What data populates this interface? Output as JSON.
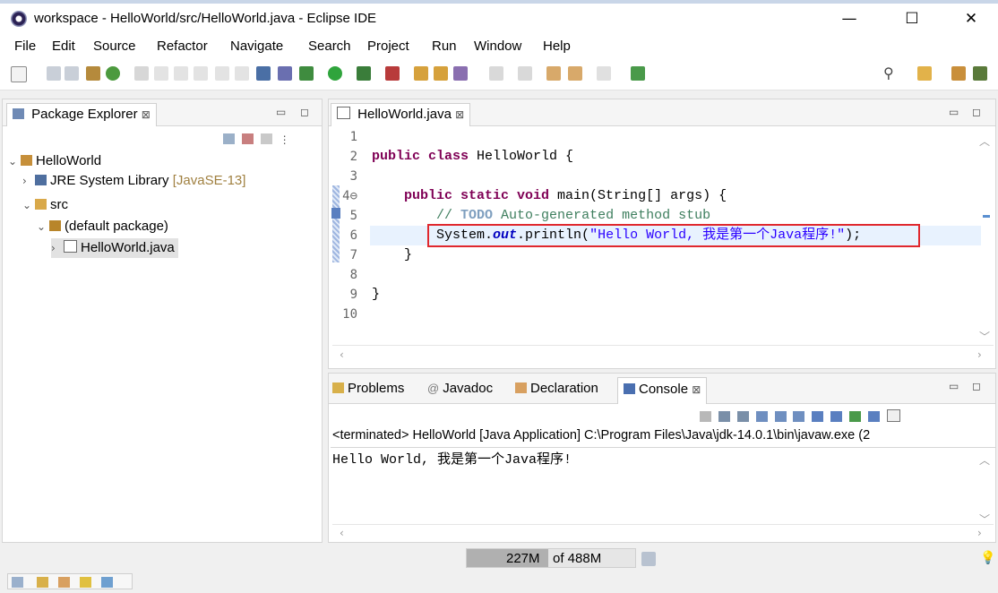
{
  "window": {
    "title": "workspace - HelloWorld/src/HelloWorld.java - Eclipse IDE",
    "minimize": "—",
    "maximize": "☐",
    "close": "✕"
  },
  "menu": [
    "File",
    "Edit",
    "Source",
    "Refactor",
    "Navigate",
    "Search",
    "Project",
    "Run",
    "Window",
    "Help"
  ],
  "package_explorer": {
    "tab_label": "Package Explorer",
    "tab_close": "⊠",
    "tree": [
      {
        "label": "HelloWorld",
        "twisty": "⌄"
      },
      {
        "label": "JRE System Library",
        "decoration": "[JavaSE-13]",
        "twisty": "›"
      },
      {
        "label": "src",
        "twisty": "⌄"
      },
      {
        "label": "(default package)",
        "twisty": "⌄"
      },
      {
        "label": "HelloWorld.java",
        "twisty": "›"
      }
    ]
  },
  "editor": {
    "tab_label": "HelloWorld.java",
    "tab_close": "⊠",
    "line_numbers": [
      "1",
      "2",
      "3",
      "4⊖",
      "5",
      "6",
      "7",
      "8",
      "9",
      "10"
    ],
    "code": {
      "l2_kw": "public class",
      "l2_rest": " HelloWorld {",
      "l4_kw": "public static void",
      "l4_rest": " main(String[] args) {",
      "l5_comment_pre": "// ",
      "l5_todo": "TODO",
      "l5_comment_post": " Auto-generated method stub",
      "l6_pre": "System.",
      "l6_field": "out",
      "l6_mid": ".println(",
      "l6_string": "\"Hello World, 我是第一个Java程序!\"",
      "l6_end": ");",
      "l7": "}",
      "l9": "}"
    }
  },
  "bottom_panel": {
    "tabs": [
      {
        "label": "Problems"
      },
      {
        "label": "Javadoc"
      },
      {
        "label": "Declaration"
      },
      {
        "label": "Console",
        "active": true
      }
    ],
    "console_tab_close": "⊠",
    "console_header": "<terminated> HelloWorld [Java Application] C:\\Program Files\\Java\\jdk-14.0.1\\bin\\javaw.exe (2",
    "console_output": "Hello World, 我是第一个Java程序!"
  },
  "status": {
    "heap_used": "227M",
    "heap_total": "of 488M"
  },
  "colors": {
    "highlight_box": "#e0282e",
    "current_line": "#e8f2fe",
    "keyword": "#7f0055",
    "string": "#2a00ff",
    "comment": "#3f7f5f",
    "heap_bar": "#b0b0b0"
  }
}
